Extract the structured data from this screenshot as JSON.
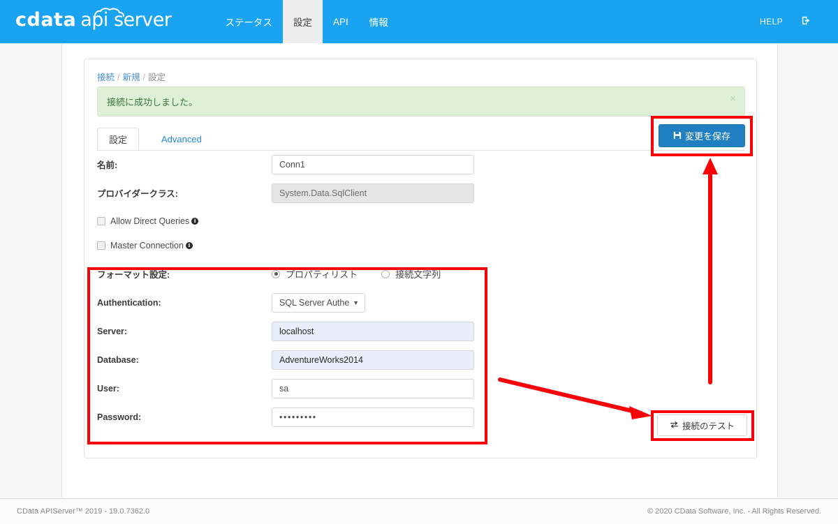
{
  "header": {
    "brand_cdata": "cdata",
    "brand_api": "api server",
    "nav_items": [
      {
        "label": "ステータス",
        "active": false
      },
      {
        "label": "設定",
        "active": true
      },
      {
        "label": "API",
        "active": false
      },
      {
        "label": "情報",
        "active": false
      }
    ],
    "help_label": "HELP",
    "logout_icon": "logout-icon"
  },
  "breadcrumb": {
    "item1": "接続",
    "item2": "新規",
    "current": "設定",
    "separator": "/"
  },
  "alert": {
    "message": "接続に成功しました。",
    "close_label": "×",
    "bg_color": "#dff0d8",
    "text_color": "#3c763d"
  },
  "tabs": [
    {
      "label": "設定",
      "active": true
    },
    {
      "label": "Advanced",
      "active": false
    }
  ],
  "form": {
    "name": {
      "label": "名前:",
      "value": "Conn1"
    },
    "provider_class": {
      "label": "プロバイダークラス:",
      "value": "System.Data.SqlClient"
    },
    "allow_direct_queries": {
      "label": "Allow Direct Queries",
      "checked": false,
      "info": "i"
    },
    "master_connection": {
      "label": "Master Connection",
      "checked": false,
      "info": "i"
    },
    "format_setting": {
      "label": "フォーマット設定:",
      "options": [
        {
          "label": "プロパティリスト",
          "checked": true
        },
        {
          "label": "接続文字列",
          "checked": false
        }
      ]
    },
    "authentication": {
      "label": "Authentication:",
      "value": "SQL Server Auther",
      "caret": "▼"
    },
    "server": {
      "label": "Server:",
      "value": "localhost"
    },
    "database": {
      "label": "Database:",
      "value": "AdventureWorks2014"
    },
    "user": {
      "label": "User:",
      "value": "sa"
    },
    "password": {
      "label": "Password:",
      "value": "•••••••••"
    }
  },
  "buttons": {
    "save": {
      "label": "変更を保存",
      "icon": "save-icon",
      "color": "#1f7fc0"
    },
    "test": {
      "label": "接続のテスト",
      "icon": "exchange-arrows-icon"
    }
  },
  "footer": {
    "left": "CData APIServer™ 2019 - 19.0.7362.0",
    "right": "© 2020 CData Software, Inc. - All Rights Reserved."
  },
  "annotations": {
    "highlight_color": "#fb0007",
    "boxes": [
      "save-button-highlight",
      "connection-form-highlight",
      "test-connection-highlight"
    ],
    "arrows": [
      "arrow-to-test-connection",
      "arrow-to-save-button"
    ]
  }
}
